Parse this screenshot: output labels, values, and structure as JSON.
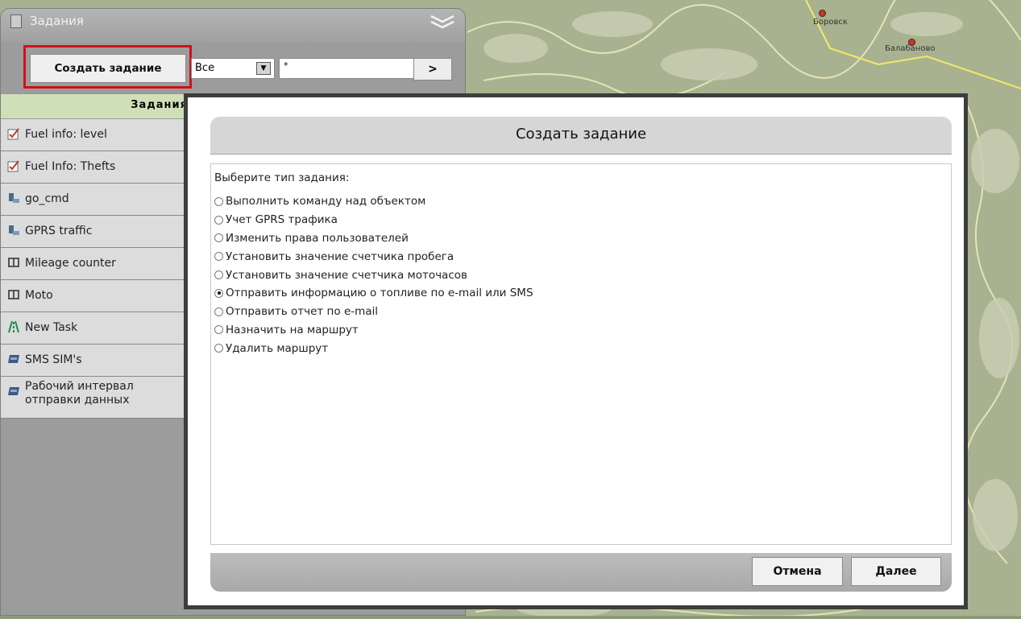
{
  "map": {
    "towns": [
      "Боровск",
      "Балабаново"
    ]
  },
  "panel": {
    "title": "Задания",
    "create_button": "Создать задание",
    "filter": {
      "selected": "Все",
      "input_value": "*"
    },
    "go_button": ">",
    "list_header": "Задания",
    "tasks": [
      {
        "label": "Fuel info: level",
        "icon": "fuel-report-icon"
      },
      {
        "label": "Fuel Info: Thefts",
        "icon": "fuel-report-icon"
      },
      {
        "label": "go_cmd",
        "icon": "command-icon"
      },
      {
        "label": "GPRS traffic",
        "icon": "command-icon"
      },
      {
        "label": "Mileage counter",
        "icon": "counter-icon"
      },
      {
        "label": "Moto",
        "icon": "counter-icon"
      },
      {
        "label": "New Task",
        "icon": "route-icon"
      },
      {
        "label": "SMS SIM's",
        "icon": "sim-icon"
      },
      {
        "label": "Рабочий интервал отправки данных",
        "icon": "sim-icon"
      }
    ]
  },
  "modal": {
    "title": "Создать задание",
    "prompt": "Выберите тип задания:",
    "options": [
      {
        "label": "Выполнить команду над объектом",
        "selected": false
      },
      {
        "label": "Учет GPRS трафика",
        "selected": false
      },
      {
        "label": "Изменить права пользователей",
        "selected": false
      },
      {
        "label": "Установить значение счетчика пробега",
        "selected": false
      },
      {
        "label": "Установить значение счетчика моточасов",
        "selected": false
      },
      {
        "label": "Отправить информацию о топливе по e-mail или SMS",
        "selected": true
      },
      {
        "label": "Отправить отчет по e-mail",
        "selected": false
      },
      {
        "label": "Назначить на маршрут",
        "selected": false
      },
      {
        "label": "Удалить маршрут",
        "selected": false
      }
    ],
    "cancel_button": "Отмена",
    "next_button": "Далее"
  },
  "colors": {
    "highlight_frame": "#d0101a",
    "list_header_bg": "#cfe0b8",
    "modal_border": "#3d3d3d"
  }
}
